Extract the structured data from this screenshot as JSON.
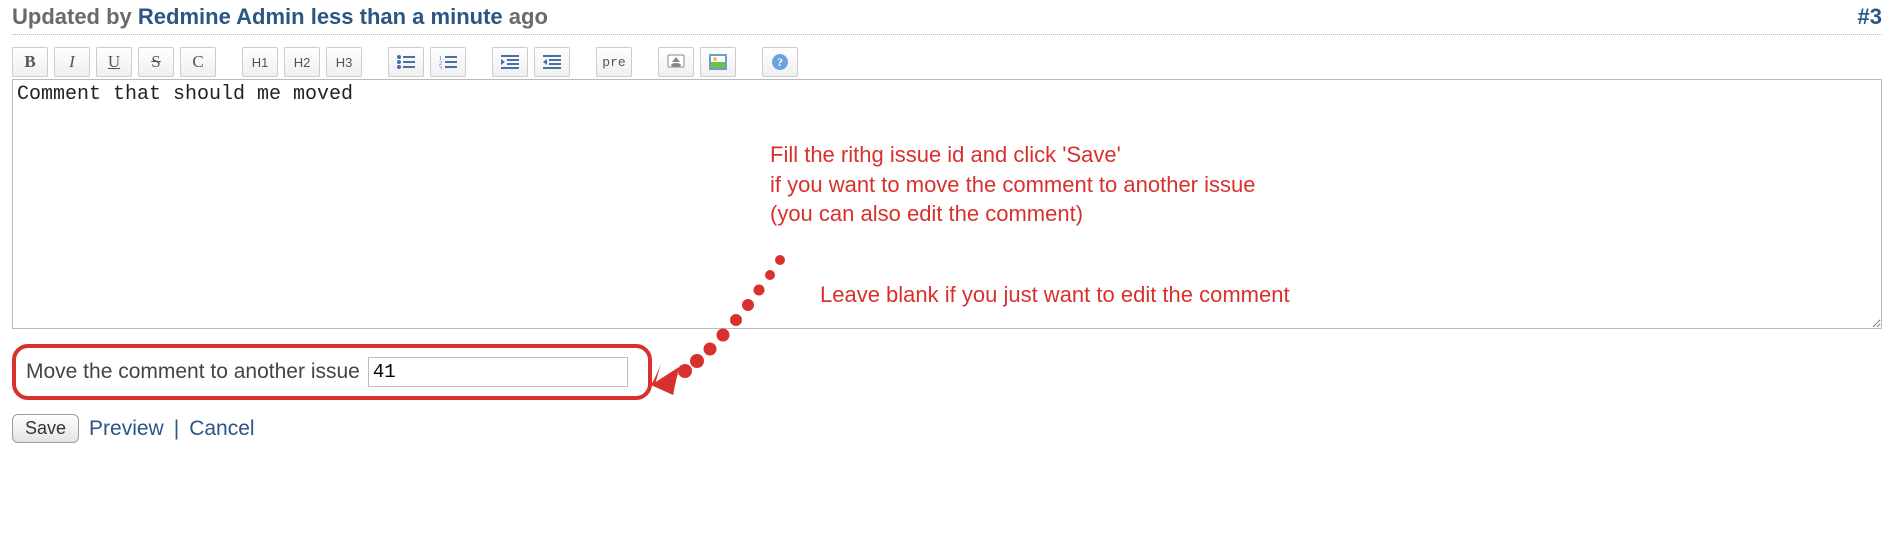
{
  "header": {
    "updated_prefix": "Updated by",
    "author": "Redmine Admin",
    "timeago": "less than a minute",
    "suffix": "ago",
    "journal_number": "#3"
  },
  "toolbar": {
    "bold": "B",
    "italic": "I",
    "underline": "U",
    "strike": "S",
    "code": "C",
    "h1": "H1",
    "h2": "H2",
    "h3": "H3",
    "pre": "pre"
  },
  "editor": {
    "value": "Comment that should me moved"
  },
  "move": {
    "label": "Move the comment to another issue",
    "value": "41"
  },
  "actions": {
    "save": "Save",
    "preview": "Preview",
    "cancel": "Cancel",
    "separator": " | "
  },
  "annotation": {
    "line1": "Fill the rithg issue id and click 'Save'",
    "line2": "if you want to move the comment to another issue",
    "line3": "(you can also edit the comment)",
    "line4": "Leave blank if you just want to edit the comment"
  }
}
